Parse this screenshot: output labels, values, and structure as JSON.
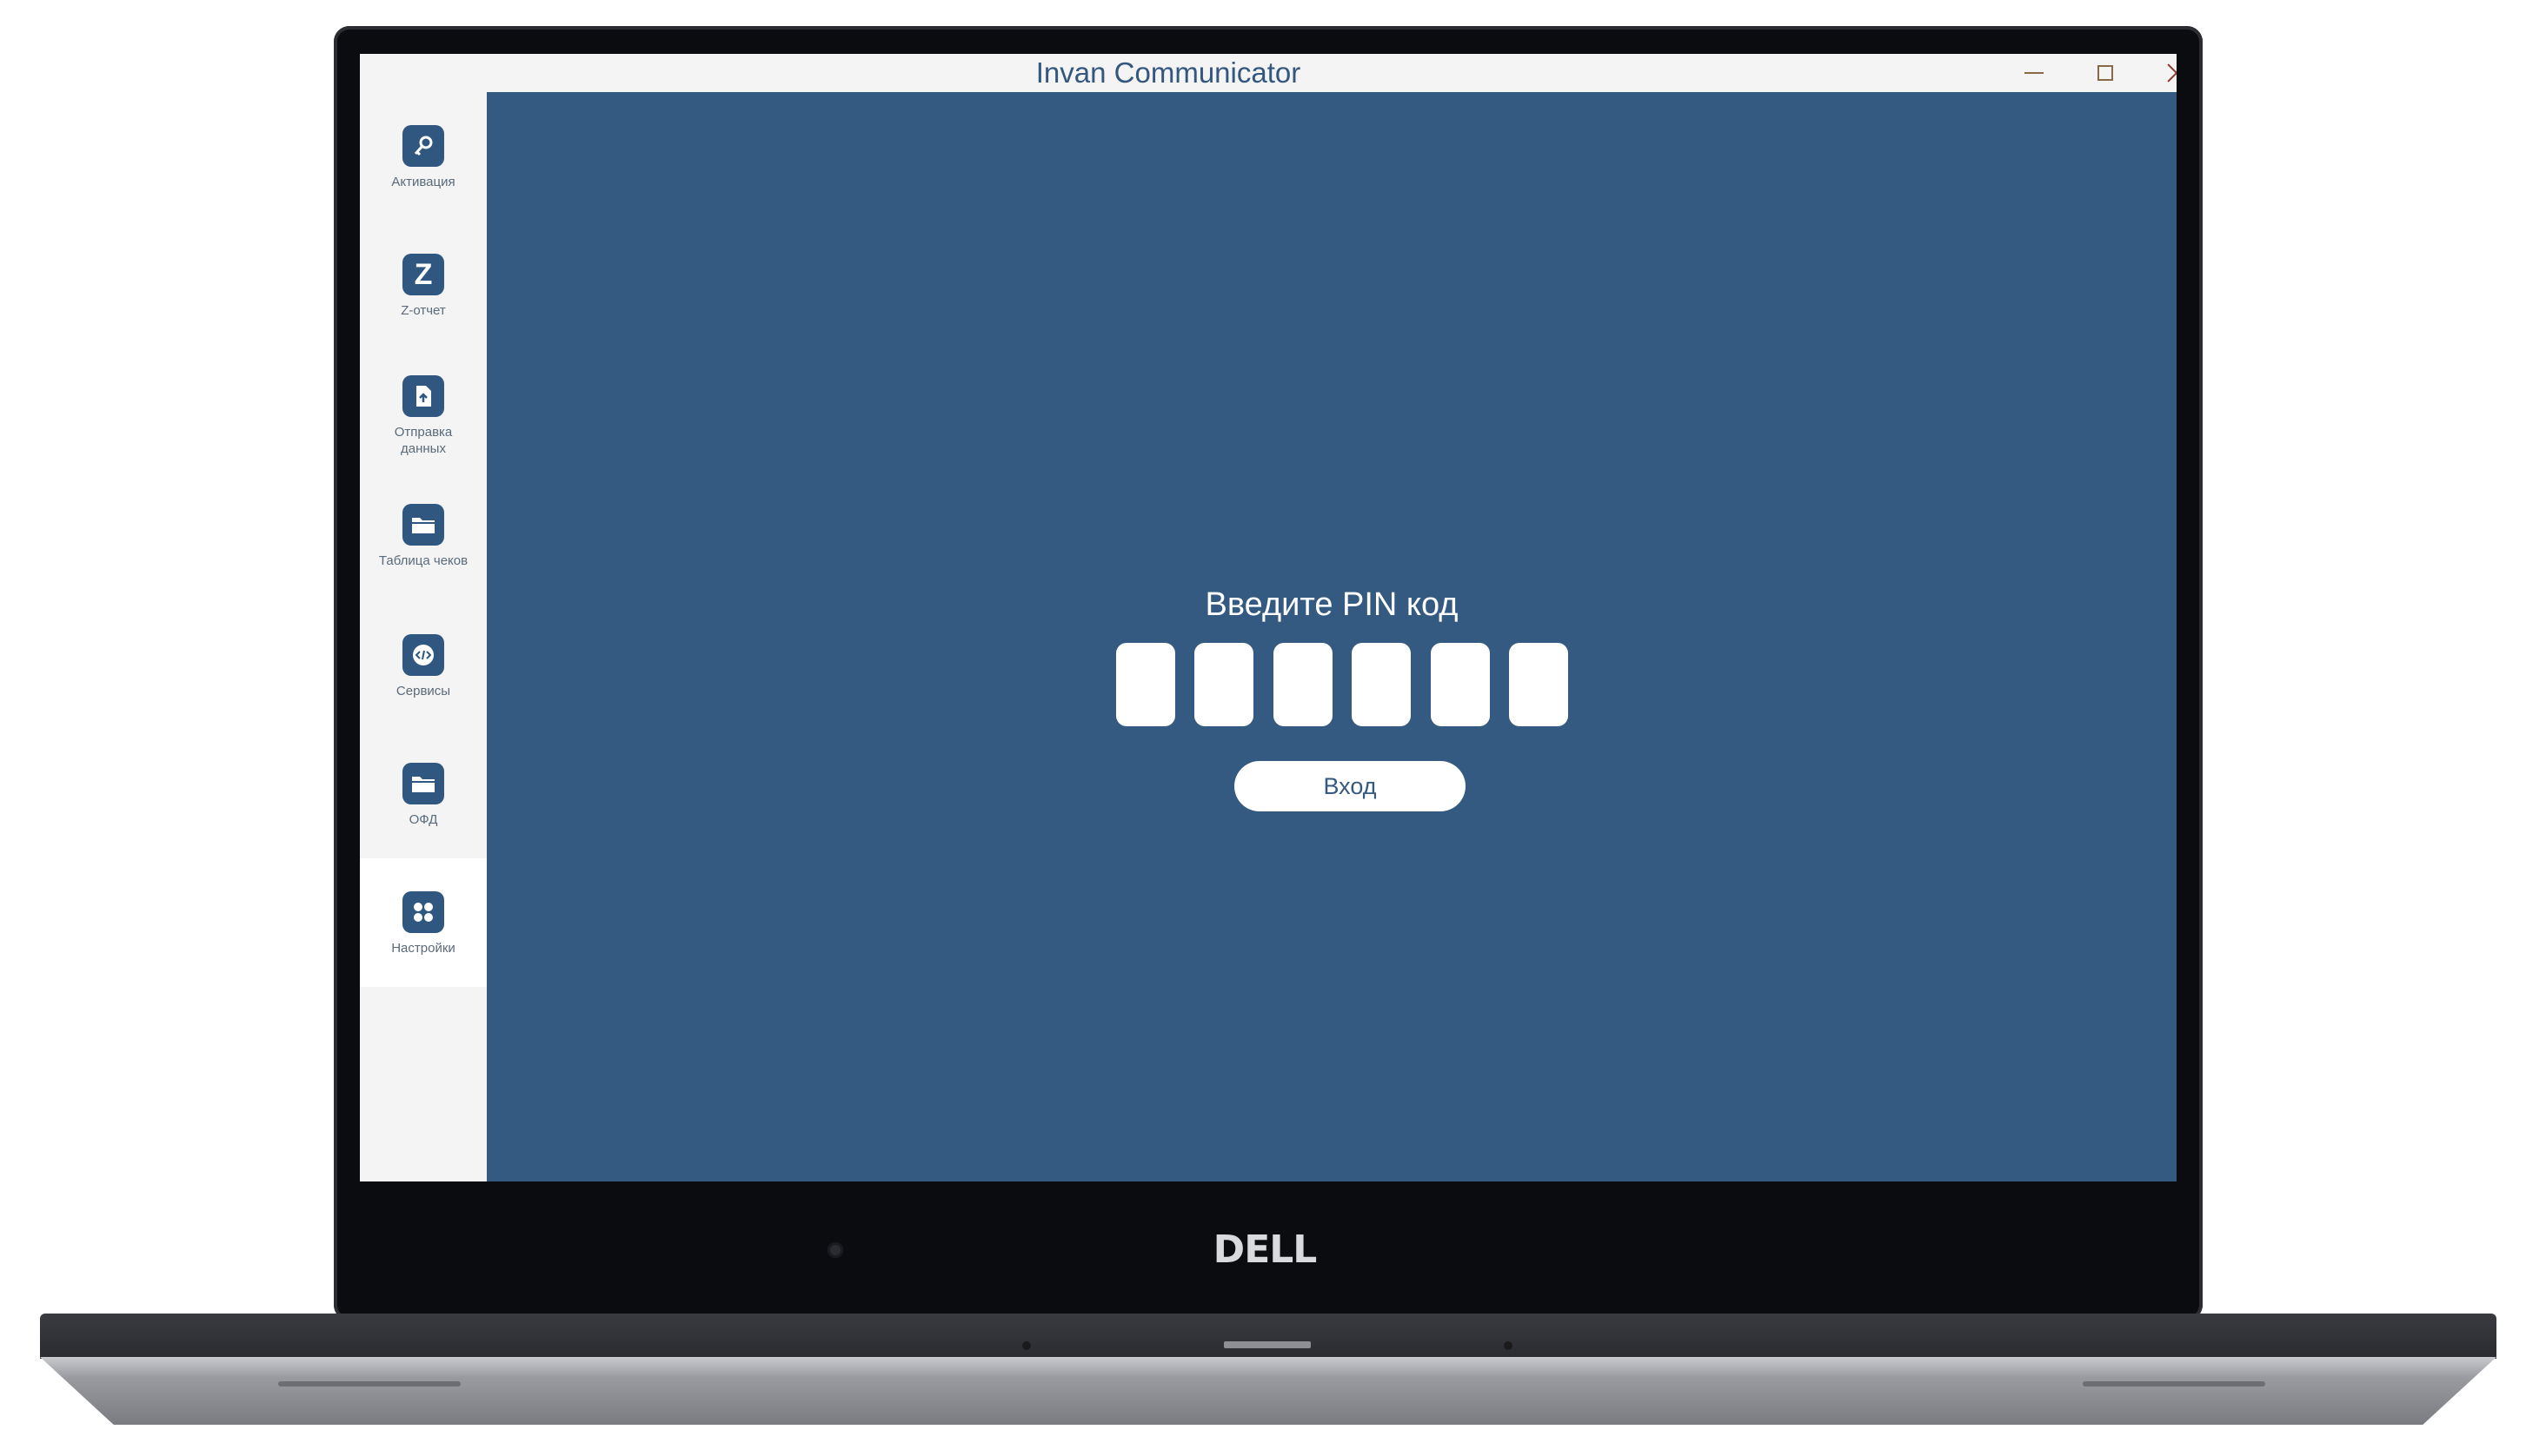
{
  "window": {
    "title": "Invan Communicator",
    "controls": [
      "minimize",
      "maximize",
      "close"
    ]
  },
  "device": {
    "brand": "DELL"
  },
  "sidebar": {
    "items": [
      {
        "label": "Активация",
        "icon": "key-icon",
        "glyph": "🔑"
      },
      {
        "label": "Z-отчет",
        "icon": "z-report-icon",
        "glyph": "Z"
      },
      {
        "label": "Отправка данных",
        "icon": "send-data-icon",
        "glyph": "⇪"
      },
      {
        "label": "Таблица чеков",
        "icon": "folder-icon",
        "glyph": "▤"
      },
      {
        "label": "Сервисы",
        "icon": "code-icon",
        "glyph": "‹/›"
      },
      {
        "label": "ОФД",
        "icon": "folder-icon",
        "glyph": "▤"
      },
      {
        "label": "Настройки",
        "icon": "grid-icon",
        "glyph": "⁘",
        "active": true
      }
    ]
  },
  "pin": {
    "title": "Введите PIN код",
    "digits": 6,
    "login_label": "Вход"
  },
  "colors": {
    "main_bg": "#345a82",
    "sidebar_bg": "#f4f4f4",
    "accent": "#2f5780"
  }
}
